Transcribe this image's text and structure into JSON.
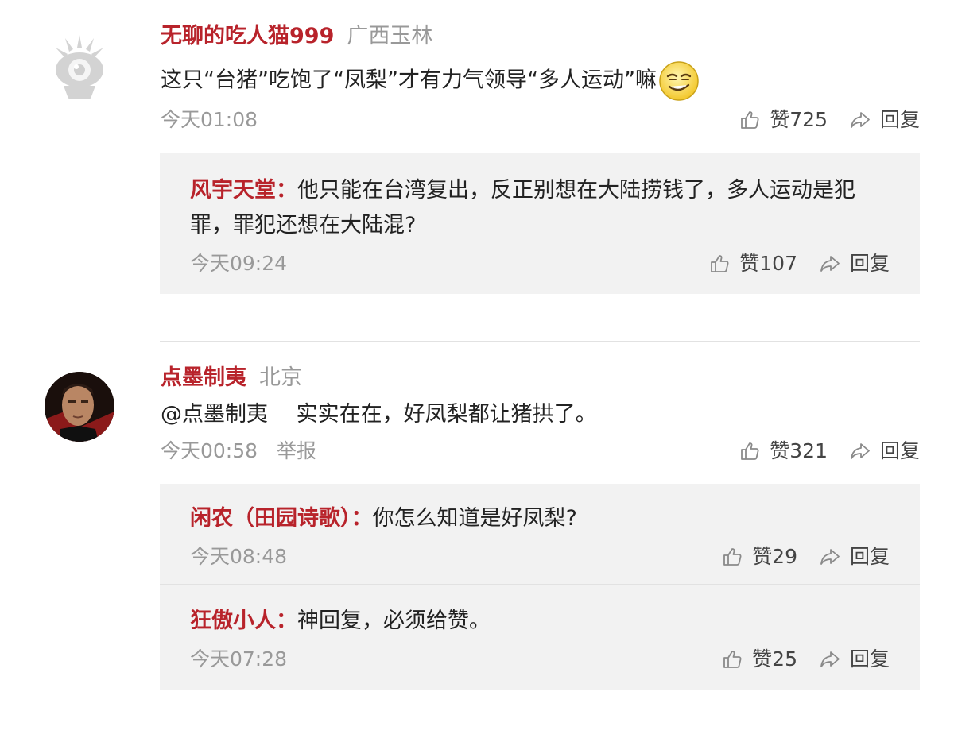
{
  "comments": [
    {
      "username": "无聊的吃人猫999",
      "location": "广西玉林",
      "text": "这只“台猪”吃饱了“凤梨”才有力气领导“多人运动”嘛",
      "emoji_icon": "smirk-face-icon",
      "time": "今天01:08",
      "likes": "赞725",
      "reply_label": "回复",
      "replies": [
        {
          "username": "风宇天堂：",
          "text": "他只能在台湾复出，反正别想在大陆捞钱了，多人运动是犯罪，罪犯还想在大陆混?",
          "time": "今天09:24",
          "likes": "赞107",
          "reply_label": "回复"
        }
      ]
    },
    {
      "username": "点墨制夷",
      "location": "北京",
      "text": "@点墨制夷　 实实在在，好凤梨都让猪拱了。",
      "time": "今天00:58",
      "report_label": "举报",
      "likes": "赞321",
      "reply_label": "回复",
      "replies": [
        {
          "username": "闲农（田园诗歌）：",
          "text": "你怎么知道是好凤梨?",
          "time": "今天08:48",
          "likes": "赞29",
          "reply_label": "回复"
        },
        {
          "username": "狂傲小人：",
          "text": "神回复，必须给赞。",
          "time": "今天07:28",
          "likes": "赞25",
          "reply_label": "回复"
        }
      ]
    }
  ],
  "colors": {
    "username": "#b8232b",
    "meta": "#999999",
    "reply_bg": "#f2f2f2"
  },
  "icons": {
    "like": "thumbs-up-icon",
    "reply": "share-arrow-icon",
    "default_avatar": "weibo-eye-avatar-icon"
  }
}
